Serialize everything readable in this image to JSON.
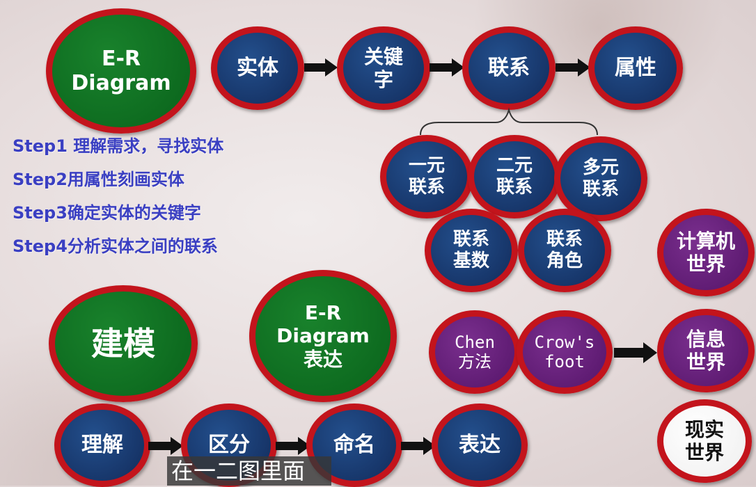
{
  "top_title": "E-R\nDiagram",
  "top_flow": [
    "实体",
    "关键\n字",
    "联系",
    "属性"
  ],
  "relationship_types": [
    "一元\n联系",
    "二元\n联系",
    "多元\n联系",
    "联系\n基数",
    "联系\n角色"
  ],
  "steps": [
    "Step1 理解需求，寻找实体",
    "Step2用属性刻画实体",
    "Step3确定实体的关键字",
    "Step4分析实体之间的联系"
  ],
  "modeling": "建模",
  "er_expression": "E-R\nDiagram\n表达",
  "bottom_flow": [
    "理解",
    "区分",
    "命名",
    "表达"
  ],
  "methods": [
    "Chen\n方法",
    "Crow's\nfoot"
  ],
  "worlds": [
    "计算机\n世界",
    "信息\n世界",
    "现实\n世界"
  ],
  "subtitle": "在一二图里面",
  "colors": {
    "ring": "#c3141c",
    "navy": "#17366a",
    "green": "#0d6a1f",
    "purple": "#5e1b72",
    "step_text": "#3a3fc2"
  }
}
